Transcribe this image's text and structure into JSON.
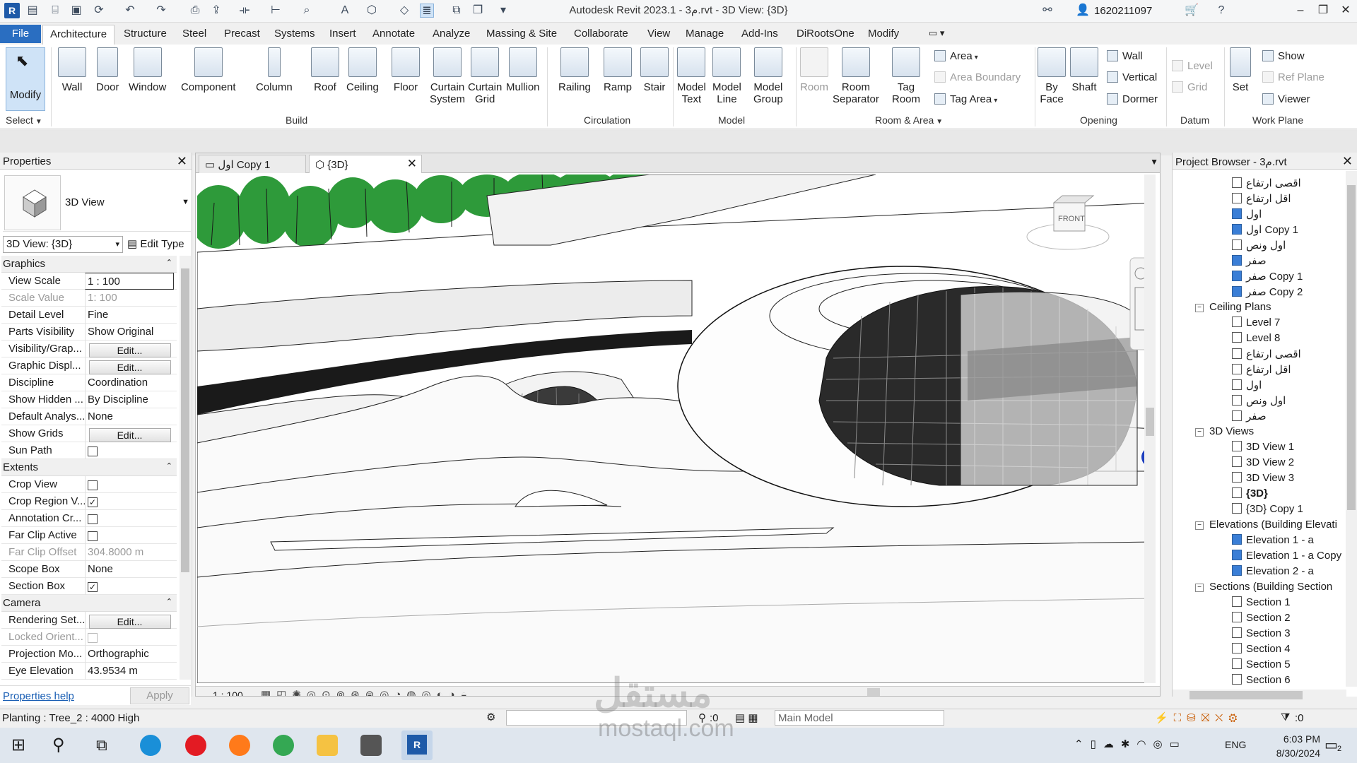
{
  "window": {
    "title": "Autodesk Revit 2023.1 - 3م.rvt - 3D View: {3D}",
    "user": "1620211097",
    "app_icon": "R"
  },
  "ribbon_tabs": [
    "File",
    "Architecture",
    "Structure",
    "Steel",
    "Precast",
    "Systems",
    "Insert",
    "Annotate",
    "Analyze",
    "Massing & Site",
    "Collaborate",
    "View",
    "Manage",
    "Add-Ins",
    "DiRootsOne",
    "Modify"
  ],
  "active_tab": "Architecture",
  "ribbon": {
    "select": {
      "modify": "Modify",
      "select_label": "Select"
    },
    "build": {
      "label": "Build",
      "wall": "Wall",
      "door": "Door",
      "window": "Window",
      "component": "Component",
      "column": "Column",
      "roof": "Roof",
      "ceiling": "Ceiling",
      "floor": "Floor",
      "curtain_system_1": "Curtain",
      "curtain_system_2": "System",
      "curtain_grid_1": "Curtain",
      "curtain_grid_2": "Grid",
      "mullion": "Mullion"
    },
    "circulation": {
      "label": "Circulation",
      "railing": "Railing",
      "ramp": "Ramp",
      "stair": "Stair"
    },
    "model": {
      "label": "Model",
      "model_text_1": "Model",
      "model_text_2": "Text",
      "model_line_1": "Model",
      "model_line_2": "Line",
      "model_group_1": "Model",
      "model_group_2": "Group"
    },
    "room_area": {
      "label": "Room & Area",
      "room": "Room",
      "room_sep_1": "Room",
      "room_sep_2": "Separator",
      "tag_room_1": "Tag",
      "tag_room_2": "Room",
      "area": "Area",
      "area_boundary": "Area  Boundary",
      "tag_area": "Tag  Area"
    },
    "opening": {
      "label": "Opening",
      "by_face_1": "By",
      "by_face_2": "Face",
      "shaft": "Shaft",
      "wall": "Wall",
      "vertical": "Vertical",
      "dormer": "Dormer"
    },
    "datum": {
      "label": "Datum",
      "level": "Level",
      "grid": "Grid"
    },
    "work_plane": {
      "label": "Work Plane",
      "set": "Set",
      "show": "Show",
      "ref_plane": "Ref  Plane",
      "viewer": "Viewer"
    }
  },
  "properties": {
    "title": "Properties",
    "type_name": "3D View",
    "view_selector": "3D View: {3D}",
    "edit_type": "Edit Type",
    "groups": {
      "graphics": "Graphics",
      "extents": "Extents",
      "camera": "Camera"
    },
    "rows": {
      "view_scale": {
        "k": "View Scale",
        "v": "1 : 100"
      },
      "scale_value": {
        "k": "Scale Value",
        "v": "1:  100"
      },
      "detail_level": {
        "k": "Detail Level",
        "v": "Fine"
      },
      "parts_visibility": {
        "k": "Parts Visibility",
        "v": "Show Original"
      },
      "visibility": {
        "k": "Visibility/Grap...",
        "v": "Edit..."
      },
      "graphic_display": {
        "k": "Graphic Displ...",
        "v": "Edit..."
      },
      "discipline": {
        "k": "Discipline",
        "v": "Coordination"
      },
      "show_hidden": {
        "k": "Show Hidden ...",
        "v": "By Discipline"
      },
      "default_analysis": {
        "k": "Default Analys...",
        "v": "None"
      },
      "show_grids": {
        "k": "Show Grids",
        "v": "Edit..."
      },
      "sun_path": {
        "k": "Sun Path",
        "v": false
      },
      "crop_view": {
        "k": "Crop View",
        "v": false
      },
      "crop_region": {
        "k": "Crop Region V...",
        "v": true
      },
      "annotation_crop": {
        "k": "Annotation Cr...",
        "v": false
      },
      "far_clip_active": {
        "k": "Far Clip Active",
        "v": false
      },
      "far_clip_offset": {
        "k": "Far Clip Offset",
        "v": "304.8000 m"
      },
      "scope_box": {
        "k": "Scope Box",
        "v": "None"
      },
      "section_box": {
        "k": "Section Box",
        "v": true
      },
      "rendering_settings": {
        "k": "Rendering Set...",
        "v": "Edit..."
      },
      "locked_orientation": {
        "k": "Locked Orient...",
        "v": false
      },
      "projection_mode": {
        "k": "Projection Mo...",
        "v": "Orthographic"
      },
      "eye_elevation": {
        "k": "Eye Elevation",
        "v": "43.9534 m"
      }
    },
    "help_link": "Properties help",
    "apply": "Apply"
  },
  "doc_tabs": [
    {
      "label": "اول Copy 1"
    },
    {
      "label": "{3D}"
    }
  ],
  "viewcube_label": "FRONT",
  "view_control_bar": {
    "scale": "1 : 100"
  },
  "project_browser": {
    "title": "Project Browser - 3م.rvt",
    "items": [
      {
        "label": "اقصى ارتفاع",
        "blue": false
      },
      {
        "label": "اقل ارتفاع",
        "blue": false
      },
      {
        "label": "اول",
        "blue": true
      },
      {
        "label": "اول Copy 1",
        "blue": true
      },
      {
        "label": "اول ونص",
        "blue": false
      },
      {
        "label": "صفر",
        "blue": true
      },
      {
        "label": "صفر Copy 1",
        "blue": true
      },
      {
        "label": "صفر Copy 2",
        "blue": true
      }
    ],
    "ceiling_plans": {
      "label": "Ceiling Plans",
      "items": [
        "Level 7",
        "Level 8",
        "اقصى ارتفاع",
        "اقل ارتفاع",
        "اول",
        "اول ونص",
        "صفر"
      ]
    },
    "views_3d": {
      "label": "3D Views",
      "items": [
        "3D View 1",
        "3D View 2",
        "3D View 3",
        "{3D}",
        "{3D} Copy 1"
      ]
    },
    "elevations": {
      "label": "Elevations (Building Elevati",
      "items": [
        "Elevation 1 - a",
        "Elevation 1 - a Copy",
        "Elevation 2 - a"
      ]
    },
    "sections": {
      "label": "Sections (Building Section",
      "items": [
        "Section 1",
        "Section 2",
        "Section 3",
        "Section 4",
        "Section 5",
        "Section 6"
      ]
    }
  },
  "status": {
    "text": "Planting : Tree_2 : 4000 High",
    "count": ":0",
    "model": "Main Model",
    "filter_count": ":0"
  },
  "taskbar": {
    "lang": "ENG",
    "time": "6:03 PM",
    "date": "8/30/2024",
    "notif": "2"
  },
  "watermark": {
    "arabic": "مستقل",
    "latin": "mostaql.com"
  }
}
